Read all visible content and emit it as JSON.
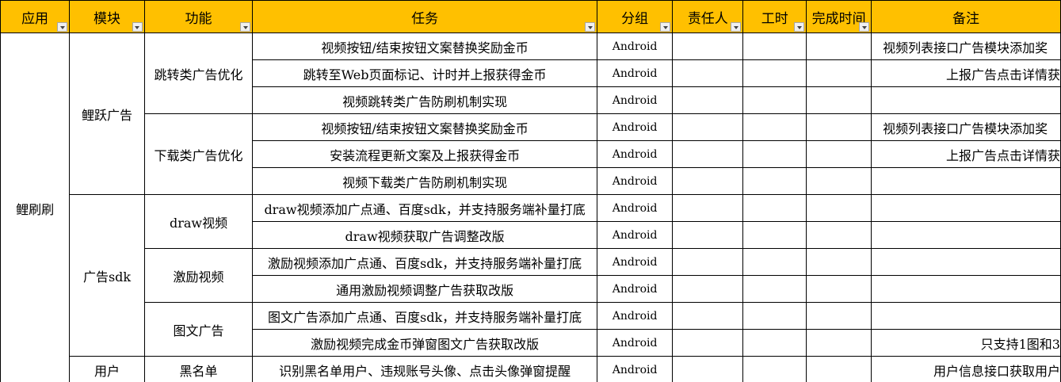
{
  "headers": {
    "app": "应用",
    "module": "模块",
    "feature": "功能",
    "task": "任务",
    "group": "分组",
    "owner": "责任人",
    "hours": "工时",
    "done_time": "完成时间",
    "remark": "备注"
  },
  "apps": [
    "鲤刷刷"
  ],
  "modules": [
    "鲤跃广告",
    "广告sdk",
    "用户"
  ],
  "features": [
    "跳转类广告优化",
    "下载类广告优化",
    "draw视频",
    "激励视频",
    "图文广告",
    "黑名单"
  ],
  "rows": [
    {
      "task": "视频按钮/结束按钮文案替换奖励金币",
      "group": "Android",
      "remark": "视频列表接口广告模块添加奖"
    },
    {
      "task": "跳转至Web页面标记、计时并上报获得金币",
      "group": "Android",
      "remark": "上报广告点击详情获"
    },
    {
      "task": "视频跳转类广告防刷机制实现",
      "group": "Android",
      "remark": ""
    },
    {
      "task": "视频按钮/结束按钮文案替换奖励金币",
      "group": "Android",
      "remark": "视频列表接口广告模块添加奖"
    },
    {
      "task": "安装流程更新文案及上报获得金币",
      "group": "Android",
      "remark": "上报广告点击详情获"
    },
    {
      "task": "视频下载类广告防刷机制实现",
      "group": "Android",
      "remark": ""
    },
    {
      "task": "draw视频添加广点通、百度sdk，并支持服务端补量打底",
      "group": "Android",
      "remark": ""
    },
    {
      "task": "draw视频获取广告调整改版",
      "group": "Android",
      "remark": ""
    },
    {
      "task": "激励视频添加广点通、百度sdk，并支持服务端补量打底",
      "group": "Android",
      "remark": ""
    },
    {
      "task": "通用激励视频调整广告获取改版",
      "group": "Android",
      "remark": ""
    },
    {
      "task": "图文广告添加广点通、百度sdk，并支持服务端补量打底",
      "group": "Android",
      "remark": ""
    },
    {
      "task": "激励视频完成金币弹窗图文广告获取改版",
      "group": "Android",
      "remark": "只支持1图和3"
    },
    {
      "task": "识别黑名单用户、违规账号头像、点击头像弹窗提醒",
      "group": "Android",
      "remark": "用户信息接口获取用户"
    }
  ]
}
